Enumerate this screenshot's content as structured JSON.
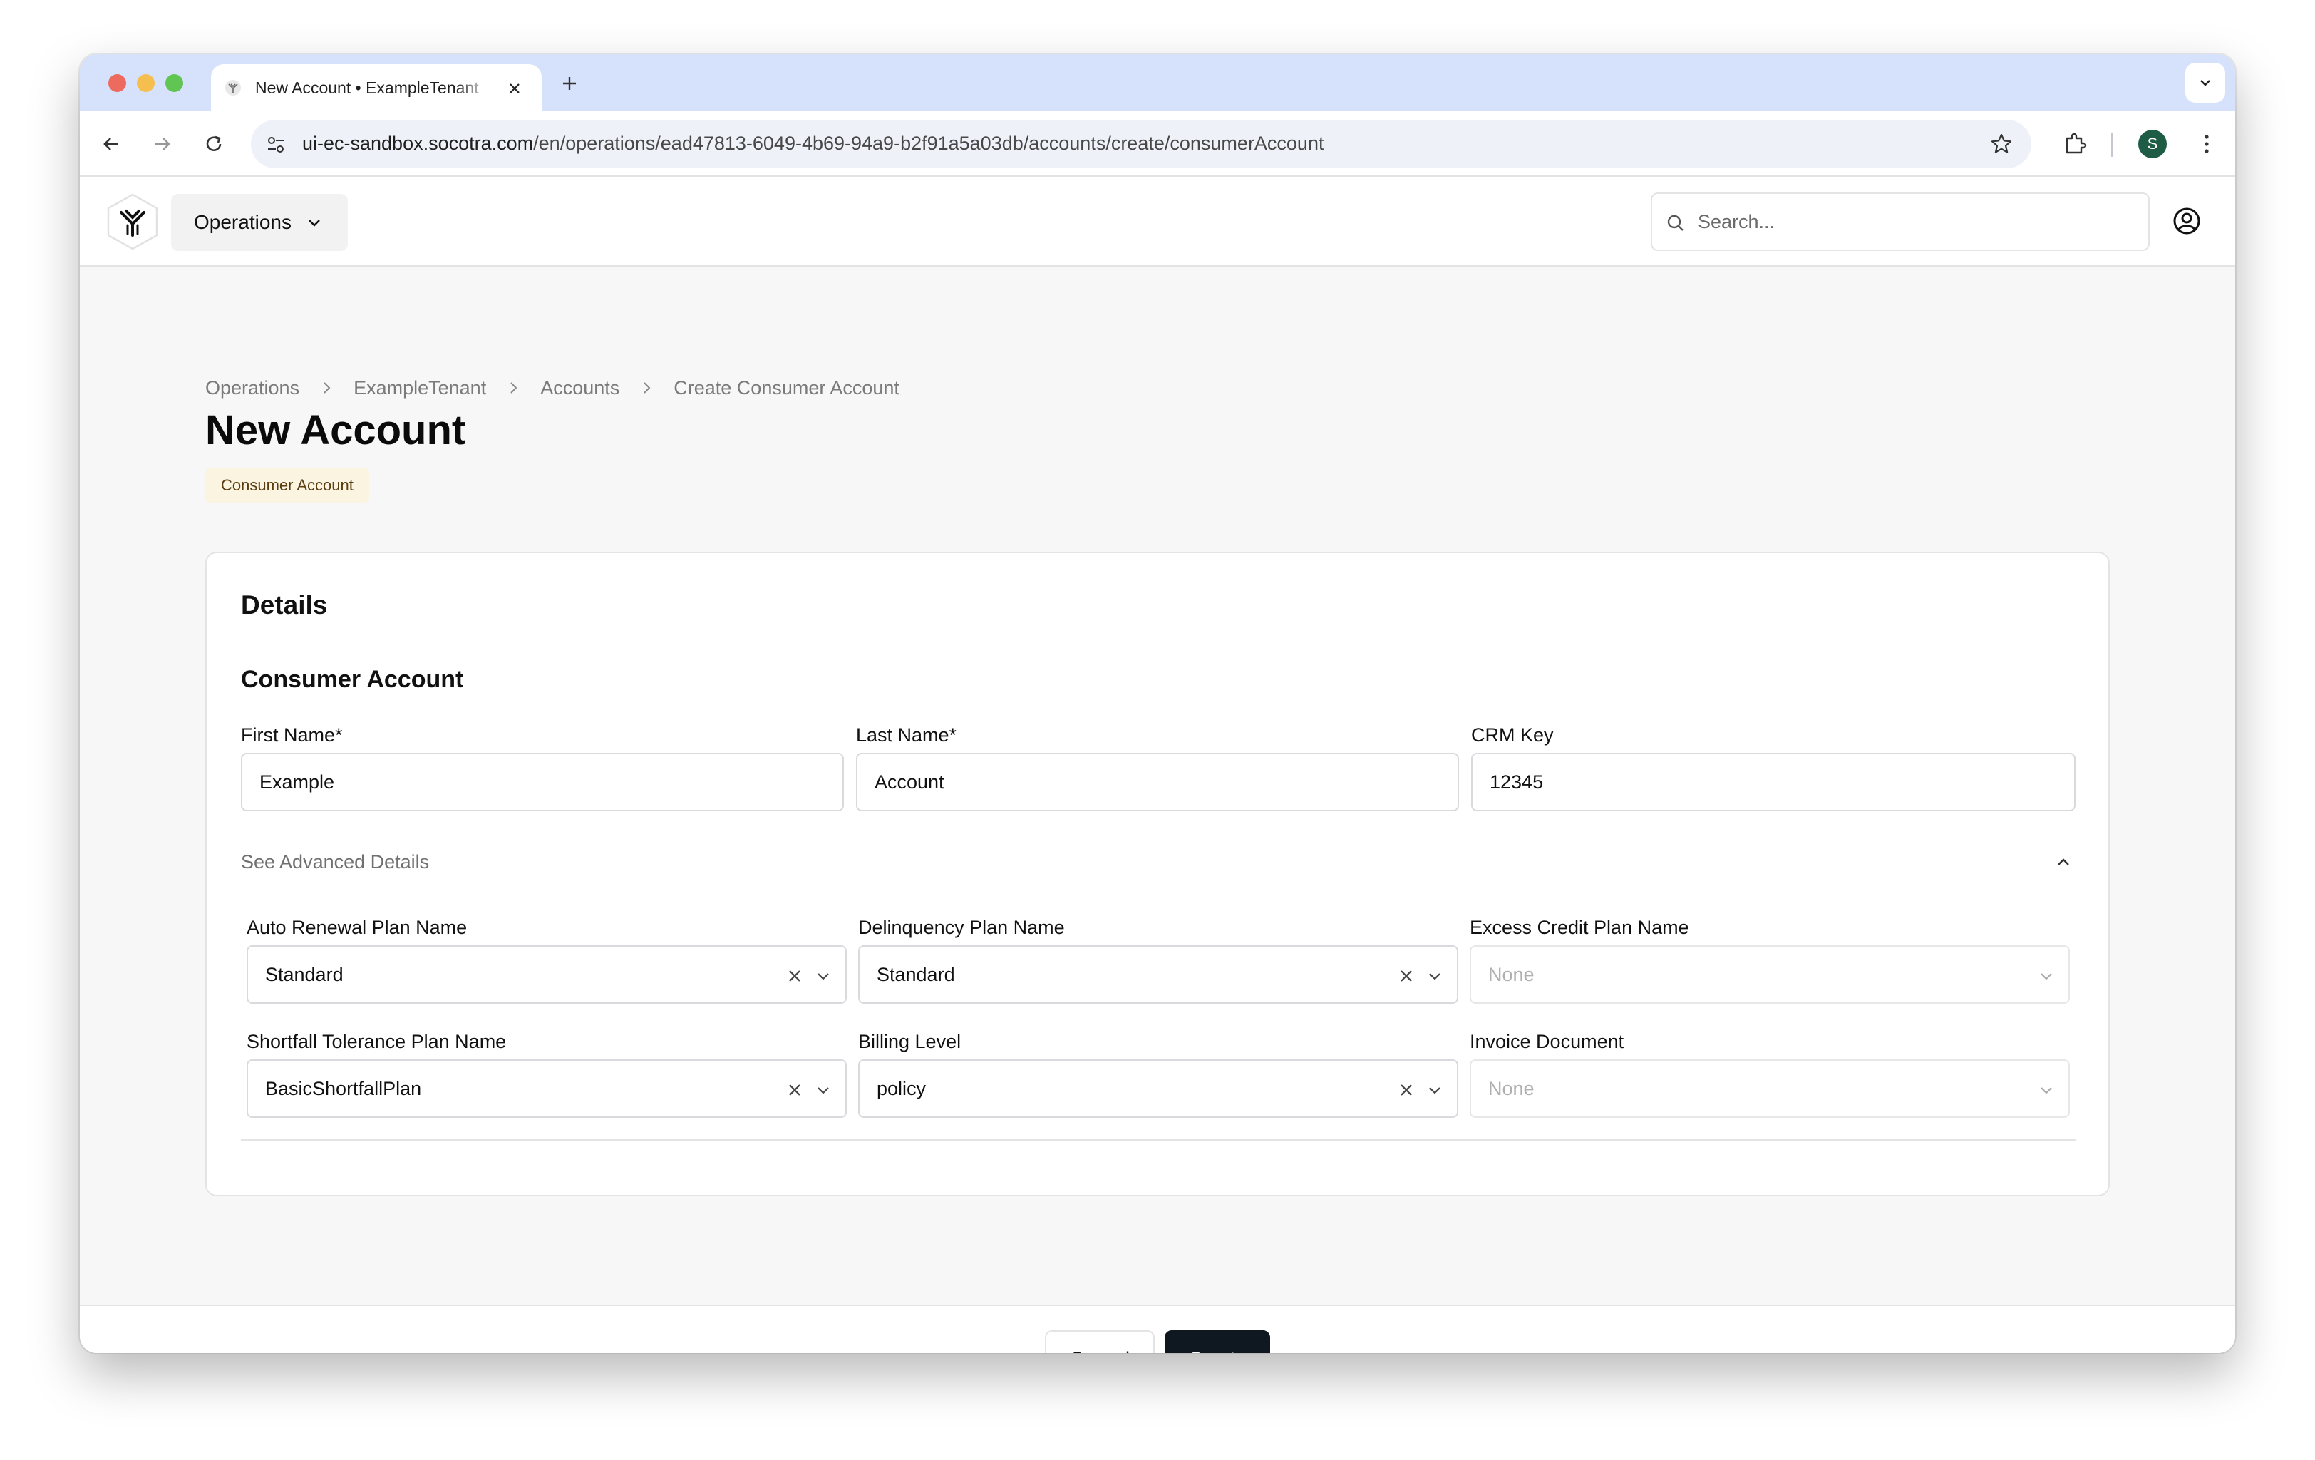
{
  "browser": {
    "tab_title": "New Account • ExampleTenant",
    "url_host": "ui-ec-sandbox.socotra.com",
    "url_path": "/en/operations/ead47813-6049-4b69-94a9-b2f91a5a03db/accounts/create/consumerAccount",
    "profile_initial": "S"
  },
  "header": {
    "menu_label": "Operations",
    "search_placeholder": "Search..."
  },
  "breadcrumb": [
    "Operations",
    "ExampleTenant",
    "Accounts",
    "Create Consumer Account"
  ],
  "page": {
    "title": "New Account",
    "badge": "Consumer Account"
  },
  "card": {
    "section_title": "Details",
    "sub_title": "Consumer Account",
    "fields": {
      "first_name_label": "First Name*",
      "first_name_value": "Example",
      "last_name_label": "Last Name*",
      "last_name_value": "Account",
      "crm_key_label": "CRM Key",
      "crm_key_value": "12345"
    },
    "advanced_toggle": "See Advanced Details",
    "advanced": {
      "auto_renewal_label": "Auto Renewal Plan Name",
      "auto_renewal_value": "Standard",
      "delinquency_label": "Delinquency Plan Name",
      "delinquency_value": "Standard",
      "excess_credit_label": "Excess Credit Plan Name",
      "excess_credit_value": "None",
      "shortfall_label": "Shortfall Tolerance Plan Name",
      "shortfall_value": "BasicShortfallPlan",
      "billing_level_label": "Billing Level",
      "billing_level_value": "policy",
      "invoice_document_label": "Invoice Document",
      "invoice_document_value": "None"
    }
  },
  "footer": {
    "cancel_label": "Cancel",
    "create_label": "Create"
  },
  "colors": {
    "tabstrip": "#d6e2fb",
    "primary_button": "#0f1720",
    "badge_bg": "#fbf4e1"
  }
}
